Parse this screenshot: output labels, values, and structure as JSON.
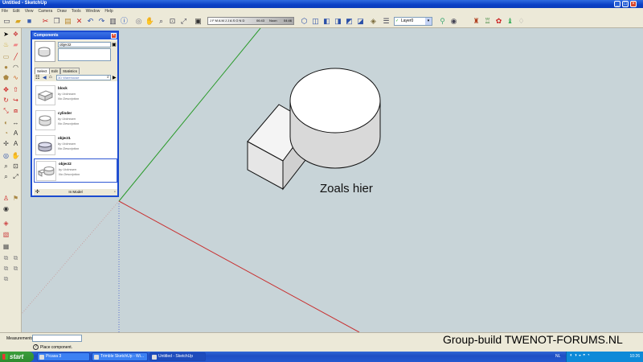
{
  "window": {
    "title": "Untitled - SketchUp"
  },
  "menu": [
    "File",
    "Edit",
    "View",
    "Camera",
    "Draw",
    "Tools",
    "Window",
    "Help"
  ],
  "toolbar": {
    "shadow_months": "J F M A M J J A S O N D",
    "shadow_time_left": "06:43",
    "shadow_noon": "Noon",
    "shadow_time_right": "04:46",
    "layer": "Layer0"
  },
  "components_panel": {
    "title": "Components",
    "selected_name": "object2",
    "tabs": [
      "Select",
      "Edit",
      "Statistics"
    ],
    "path": "3D Warehouse",
    "items": [
      {
        "name": "block",
        "author": "by Unknown",
        "description": "No Description"
      },
      {
        "name": "cylinder",
        "author": "by Unknown",
        "description": "No Description"
      },
      {
        "name": "object1",
        "author": "by Unknown",
        "description": "No Description"
      },
      {
        "name": "object2",
        "author": "by Unknown",
        "description": "No Description"
      }
    ],
    "footer": "In Model"
  },
  "viewport": {
    "caption": "Zoals hier"
  },
  "status": {
    "measurements_label": "Measurements",
    "hint": "Place component.",
    "watermark": "Group-build TWENOT-FORUMS.NL"
  },
  "taskbar": {
    "start": "start",
    "tasks": [
      "Picasa 3",
      "Trimble SketchUp - Wi...",
      "Untitled - SketchUp"
    ],
    "lang": "NL",
    "clock": "10:26"
  },
  "colors": {
    "viewport_bg": "#c8d4d8",
    "axis_green": "#2a9a2a",
    "axis_red": "#c83030",
    "xp_blue": "#1b4bd0"
  }
}
